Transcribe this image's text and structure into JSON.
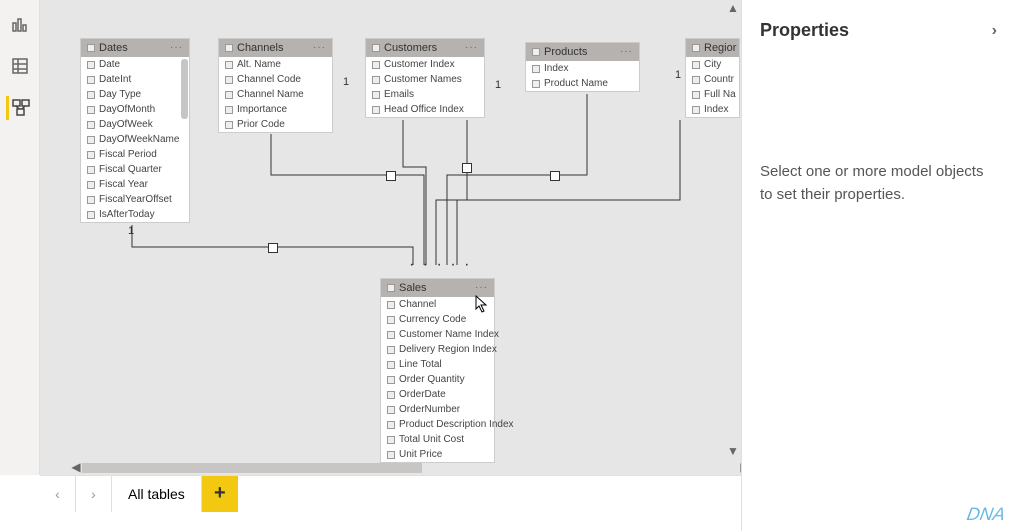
{
  "left_rail": {
    "report_icon": "report-view",
    "data_icon": "data-view",
    "model_icon": "model-view"
  },
  "tables": {
    "dates": {
      "title": "Dates",
      "fields": [
        "Date",
        "DateInt",
        "Day Type",
        "DayOfMonth",
        "DayOfWeek",
        "DayOfWeekName",
        "Fiscal Period",
        "Fiscal Quarter",
        "Fiscal Year",
        "FiscalYearOffset",
        "IsAfterToday"
      ]
    },
    "channels": {
      "title": "Channels",
      "fields": [
        "Alt. Name",
        "Channel Code",
        "Channel Name",
        "Importance",
        "Prior Code"
      ]
    },
    "customers": {
      "title": "Customers",
      "fields": [
        "Customer Index",
        "Customer Names",
        "Emails",
        "Head Office Index"
      ]
    },
    "products": {
      "title": "Products",
      "fields": [
        "Index",
        "Product Name"
      ]
    },
    "regions": {
      "title": "Regior",
      "fields": [
        "City",
        "Countr",
        "Full Na",
        "Index"
      ]
    },
    "sales": {
      "title": "Sales",
      "fields": [
        "Channel",
        "Currency Code",
        "Customer Name Index",
        "Delivery Region Index",
        "Line Total",
        "Order Quantity",
        "OrderDate",
        "OrderNumber",
        "Product Description Index",
        "Total Unit Cost",
        "Unit Price"
      ]
    }
  },
  "tab_strip": {
    "tab_label": "All tables"
  },
  "properties": {
    "title": "Properties",
    "message": "Select one or more model objects to set their properties."
  }
}
